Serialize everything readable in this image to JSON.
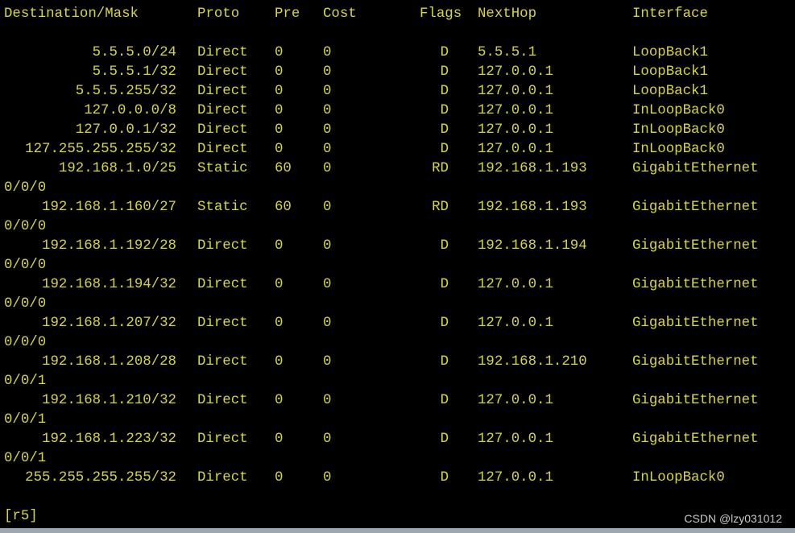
{
  "header": {
    "destination_mask": "Destination/Mask",
    "proto": "Proto",
    "pre": "Pre",
    "cost": "Cost",
    "flags": "Flags",
    "nexthop": "NextHop",
    "interface": "Interface"
  },
  "routes": [
    {
      "dest": "5.5.5.0/24",
      "proto": "Direct",
      "pre": "0",
      "cost": "0",
      "flags": "D",
      "nexthop": "5.5.5.1",
      "iface": "LoopBack1",
      "iface_cont": ""
    },
    {
      "dest": "5.5.5.1/32",
      "proto": "Direct",
      "pre": "0",
      "cost": "0",
      "flags": "D",
      "nexthop": "127.0.0.1",
      "iface": "LoopBack1",
      "iface_cont": ""
    },
    {
      "dest": "5.5.5.255/32",
      "proto": "Direct",
      "pre": "0",
      "cost": "0",
      "flags": "D",
      "nexthop": "127.0.0.1",
      "iface": "LoopBack1",
      "iface_cont": ""
    },
    {
      "dest": "127.0.0.0/8",
      "proto": "Direct",
      "pre": "0",
      "cost": "0",
      "flags": "D",
      "nexthop": "127.0.0.1",
      "iface": "InLoopBack0",
      "iface_cont": ""
    },
    {
      "dest": "127.0.0.1/32",
      "proto": "Direct",
      "pre": "0",
      "cost": "0",
      "flags": "D",
      "nexthop": "127.0.0.1",
      "iface": "InLoopBack0",
      "iface_cont": ""
    },
    {
      "dest": "127.255.255.255/32",
      "proto": "Direct",
      "pre": "0",
      "cost": "0",
      "flags": "D",
      "nexthop": "127.0.0.1",
      "iface": "InLoopBack0",
      "iface_cont": ""
    },
    {
      "dest": "192.168.1.0/25",
      "proto": "Static",
      "pre": "60",
      "cost": "0",
      "flags": "RD",
      "nexthop": "192.168.1.193",
      "iface": "GigabitEthernet",
      "iface_cont": "0/0/0"
    },
    {
      "dest": "192.168.1.160/27",
      "proto": "Static",
      "pre": "60",
      "cost": "0",
      "flags": "RD",
      "nexthop": "192.168.1.193",
      "iface": "GigabitEthernet",
      "iface_cont": "0/0/0"
    },
    {
      "dest": "192.168.1.192/28",
      "proto": "Direct",
      "pre": "0",
      "cost": "0",
      "flags": "D",
      "nexthop": "192.168.1.194",
      "iface": "GigabitEthernet",
      "iface_cont": "0/0/0"
    },
    {
      "dest": "192.168.1.194/32",
      "proto": "Direct",
      "pre": "0",
      "cost": "0",
      "flags": "D",
      "nexthop": "127.0.0.1",
      "iface": "GigabitEthernet",
      "iface_cont": "0/0/0"
    },
    {
      "dest": "192.168.1.207/32",
      "proto": "Direct",
      "pre": "0",
      "cost": "0",
      "flags": "D",
      "nexthop": "127.0.0.1",
      "iface": "GigabitEthernet",
      "iface_cont": "0/0/0"
    },
    {
      "dest": "192.168.1.208/28",
      "proto": "Direct",
      "pre": "0",
      "cost": "0",
      "flags": "D",
      "nexthop": "192.168.1.210",
      "iface": "GigabitEthernet",
      "iface_cont": "0/0/1"
    },
    {
      "dest": "192.168.1.210/32",
      "proto": "Direct",
      "pre": "0",
      "cost": "0",
      "flags": "D",
      "nexthop": "127.0.0.1",
      "iface": "GigabitEthernet",
      "iface_cont": "0/0/1"
    },
    {
      "dest": "192.168.1.223/32",
      "proto": "Direct",
      "pre": "0",
      "cost": "0",
      "flags": "D",
      "nexthop": "127.0.0.1",
      "iface": "GigabitEthernet",
      "iface_cont": "0/0/1"
    },
    {
      "dest": "255.255.255.255/32",
      "proto": "Direct",
      "pre": "0",
      "cost": "0",
      "flags": "D",
      "nexthop": "127.0.0.1",
      "iface": "InLoopBack0",
      "iface_cont": ""
    }
  ],
  "prompt": "[r5]",
  "watermark": "CSDN @lzy031012",
  "colors": {
    "background": "#000000",
    "text": "#d6d63a",
    "watermark": "#c8c8c8",
    "bottom_bar": "#9ea6b0"
  }
}
